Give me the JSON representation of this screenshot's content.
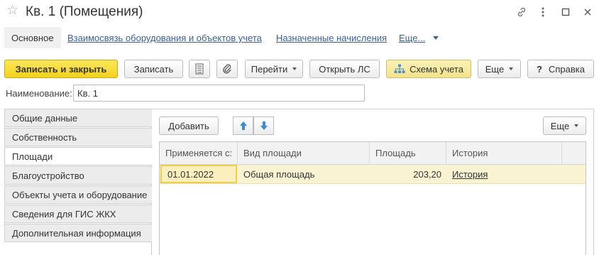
{
  "window": {
    "title": "Кв. 1 (Помещения)",
    "icons": [
      "star-icon",
      "link-icon",
      "more-vert-icon",
      "maximize-icon",
      "close-icon"
    ]
  },
  "nav": {
    "active": "Основное",
    "links": [
      "Взаимосвязь оборудования и объектов учета",
      "Назначенные начисления"
    ],
    "more": "Еще..."
  },
  "toolbar": {
    "save_close": "Записать и закрыть",
    "save": "Записать",
    "goto": "Перейти",
    "open_ls": "Открыть ЛС",
    "scheme": "Схема учета",
    "more": "Еще",
    "help_mark": "?",
    "help": "Справка"
  },
  "form": {
    "name_label": "Наименование:",
    "name_value": "Кв. 1"
  },
  "side_tabs": [
    "Общие данные",
    "Собственность",
    "Площади",
    "Благоустройство",
    "Объекты учета и оборудование",
    "Сведения для ГИС ЖКХ",
    "Дополнительная информация"
  ],
  "side_tab_active": "Площади",
  "grid": {
    "add": "Добавить",
    "more": "Еще",
    "columns": [
      "Применяется с:",
      "Вид площади",
      "Площадь",
      "История"
    ],
    "rows": [
      {
        "date": "01.01.2022",
        "type": "Общая площадь",
        "area": "203,20",
        "history": "История"
      }
    ]
  },
  "colors": {
    "primary_button": "#f4d21a",
    "link": "#3c5e9d",
    "selected_row": "#faf3d1",
    "arrow_icons": "#3a8ad6"
  }
}
